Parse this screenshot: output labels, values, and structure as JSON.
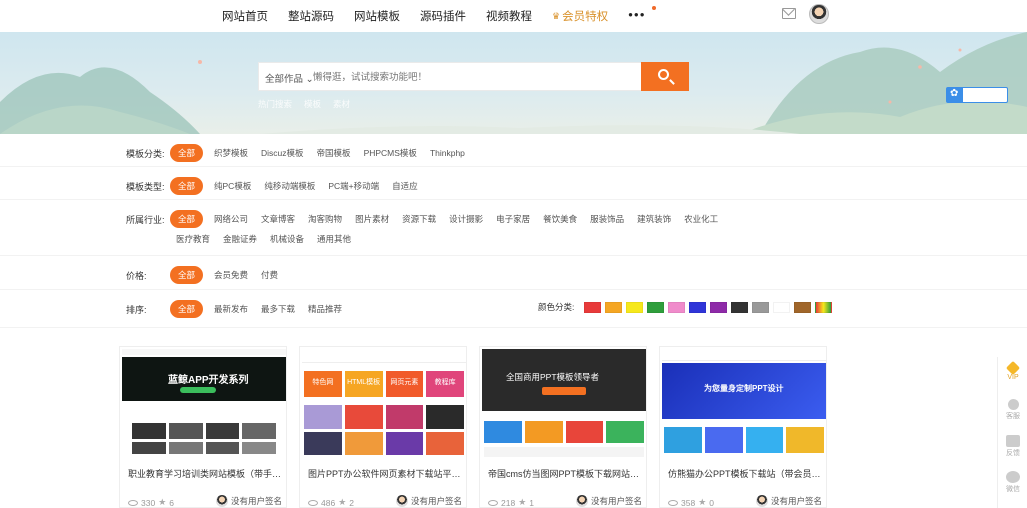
{
  "nav": {
    "items": [
      "网站首页",
      "整站源码",
      "网站模板",
      "源码插件",
      "视频教程"
    ],
    "vip_label": "会员特权",
    "more_label": "●●●"
  },
  "search": {
    "category": "全部作品 ⌄",
    "placeholder": "懒得逛，试试搜索功能吧！",
    "hot_words": [
      "热门搜索",
      "模板",
      "素材"
    ]
  },
  "filters": {
    "template_category": {
      "label": "模板分类:",
      "options": [
        "全部",
        "织梦模板",
        "Discuz模板",
        "帝国模板",
        "PHPCMS模板",
        "Thinkphp"
      ]
    },
    "template_type": {
      "label": "模板类型:",
      "options": [
        "全部",
        "纯PC模板",
        "纯移动端模板",
        "PC端+移动端",
        "自适应"
      ]
    },
    "industry": {
      "label": "所属行业:",
      "options": [
        "全部",
        "网络公司",
        "文章博客",
        "淘客购物",
        "图片素材",
        "资源下载",
        "设计摄影",
        "电子家居",
        "餐饮美食",
        "服装饰品",
        "建筑装饰",
        "农业化工"
      ],
      "options_row2": [
        "医疗教育",
        "金融证券",
        "机械设备",
        "通用其他"
      ]
    },
    "price": {
      "label": "价格:",
      "options": [
        "全部",
        "会员免费",
        "付费"
      ]
    },
    "sort": {
      "label": "排序:",
      "options": [
        "全部",
        "最新发布",
        "最多下载",
        "精品推荐"
      ]
    },
    "color": {
      "label": "颜色分类:",
      "swatches": [
        "#e83a3a",
        "#f5a623",
        "#f6e81c",
        "#2f9e3c",
        "#f08bcb",
        "#2f35d8",
        "#8e2aa8",
        "#333333",
        "#999999",
        "#ffffff",
        "#a0662a",
        "linear-gradient(90deg,#e83a3a,#f6e81c,#2f9e3c)"
      ]
    }
  },
  "cards": [
    {
      "title": "职业教育学习培训类网站模板（带手机...",
      "views": "330",
      "stars": "6",
      "author": "没有用户签名",
      "thumb_banner": "蓝鲸APP开发系列"
    },
    {
      "title": "图片PPT办公软件网页素材下载站平台...",
      "views": "486",
      "stars": "2",
      "author": "没有用户签名",
      "thumb_tabs": [
        "特色网",
        "HTML模板",
        "网页元素",
        "教程库"
      ]
    },
    {
      "title": "帝国cms仿当图网PPT模板下载网站源...",
      "views": "218",
      "stars": "1",
      "author": "没有用户签名",
      "thumb_banner": "全国商用PPT模板领导者"
    },
    {
      "title": "仿熊猫办公PPT模板下载站（带会员、...",
      "views": "358",
      "stars": "0",
      "author": "没有用户签名",
      "thumb_banner": "为您量身定制PPT设计"
    }
  ],
  "sidebar": {
    "items": [
      "VIP",
      "客服",
      "反馈",
      "微信"
    ]
  },
  "colors": {
    "accent": "#f37021",
    "vip": "#d9912a"
  }
}
